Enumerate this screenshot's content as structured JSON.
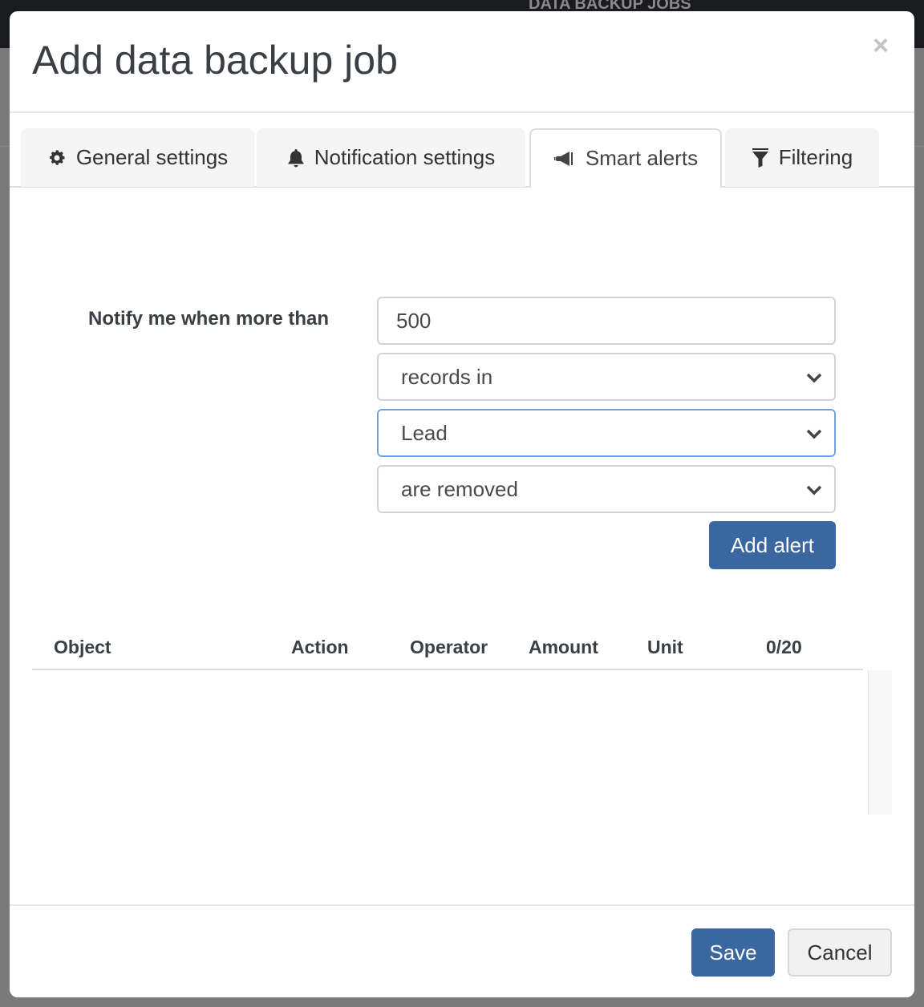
{
  "background": {
    "page_title": "DATA BACKUP JOBS"
  },
  "modal": {
    "title": "Add data backup job",
    "close_icon": "close-icon",
    "tabs": [
      {
        "label": "General settings",
        "icon": "gear-icon",
        "active": false
      },
      {
        "label": "Notification settings",
        "icon": "bell-icon",
        "active": false
      },
      {
        "label": "Smart alerts",
        "icon": "bullhorn-icon",
        "active": true
      },
      {
        "label": "Filtering",
        "icon": "filter-icon",
        "active": false
      }
    ],
    "form": {
      "notify_label": "Notify me when more than",
      "amount_value": "500",
      "unit_select": "records in",
      "object_select": "Lead",
      "action_select": "are removed",
      "add_alert_label": "Add alert"
    },
    "table": {
      "columns": [
        "Object",
        "Action",
        "Operator",
        "Amount",
        "Unit",
        "0/20"
      ],
      "rows": []
    },
    "footer": {
      "save_label": "Save",
      "cancel_label": "Cancel"
    }
  },
  "colors": {
    "primary": "#3b67a0",
    "focus_border": "#6ea6dc",
    "text": "#3a3f45"
  }
}
